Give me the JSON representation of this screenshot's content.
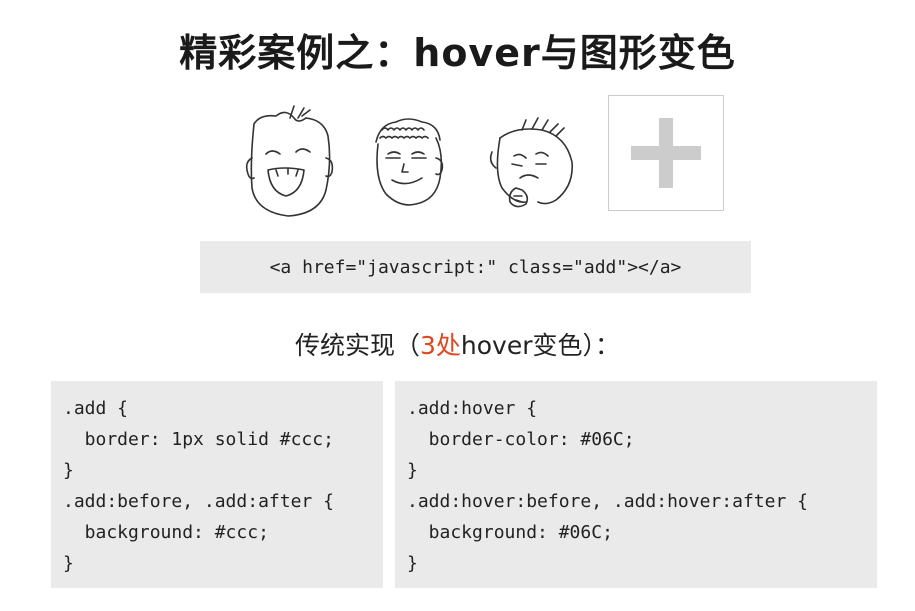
{
  "slide": {
    "title": "精彩案例之：hover与图形变色",
    "markup_example": "<a href=\"javascript:\" class=\"add\"></a>",
    "subtitle_before": "传统实现（",
    "subtitle_highlight": "3处",
    "subtitle_after": "hover变色）：",
    "highlight_color": "#e0461f",
    "plus_color": "#cccccc"
  },
  "code_left": {
    "lines": [
      ".add {",
      "  border: 1px solid #ccc;",
      "}",
      ".add:before, .add:after {",
      "  background: #ccc;",
      "}"
    ]
  },
  "code_right": {
    "lines": [
      ".add:hover {",
      "  border-color: #06C;",
      "}",
      ".add:hover:before, .add:hover:after {",
      "  background: #06C;",
      "}"
    ]
  },
  "icons": [
    "laughing-face-icon",
    "smiling-face-icon",
    "sad-face-icon",
    "plus-icon"
  ]
}
